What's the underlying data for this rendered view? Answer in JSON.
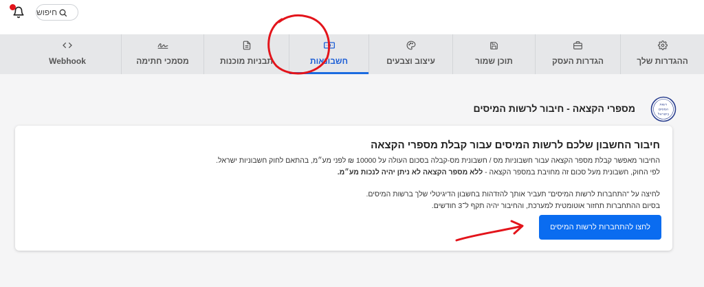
{
  "header": {
    "search_placeholder": "חיפוש"
  },
  "tabs": [
    {
      "label": "ההגדרות שלך",
      "icon": "gear-icon"
    },
    {
      "label": "הגדרות העסק",
      "icon": "briefcase-icon"
    },
    {
      "label": "תוכן שמור",
      "icon": "save-icon"
    },
    {
      "label": "עיצוב וצבעים",
      "icon": "palette-icon"
    },
    {
      "label": "חשבונאות",
      "icon": "banknote-icon",
      "active": true
    },
    {
      "label": "תבניות מוכנות",
      "icon": "document-icon"
    },
    {
      "label": "מסמכי חתימה",
      "icon": "signature-icon"
    },
    {
      "label": "Webhook",
      "icon": "code-icon"
    }
  ],
  "section": {
    "title": "מספרי הקצאה - חיבור לרשות המיסים",
    "logo_text": [
      "רשות",
      "המסים",
      "בישראל"
    ]
  },
  "card": {
    "heading": "חיבור החשבון שלכם לרשות המיסים עבור קבלת מספרי הקצאה",
    "line1": "החיבור מאפשר קבלת מספר הקצאה עבור חשבוניות מס / חשבונית מס-קבלה בסכום העולה על 10000 ₪ לפני מע״מ, בהתאם לחוק חשבוניות ישראל.",
    "line2_prefix": "לפי החוק, חשבונית מעל סכום זה מחויבת במספר הקצאה - ",
    "line2_bold": "ללא מספר הקצאה לא ניתן יהיה לנכות מע״מ.",
    "line3": "לחיצה על \"התחברות לרשות המיסים\" תעביר אותך להזדהות בחשבון הדיגיטלי שלך ברשות המיסים.",
    "line4": "בסיום ההתחברות תחזור אוטומטית למערכת, והחיבור יהיה תקף ל־3 חודשים.",
    "button_label": "לחצו להתחברות לרשות המיסים"
  },
  "colors": {
    "accent": "#0a6cf0",
    "annotation": "#e3141b",
    "notification_dot": "#e3141b"
  }
}
